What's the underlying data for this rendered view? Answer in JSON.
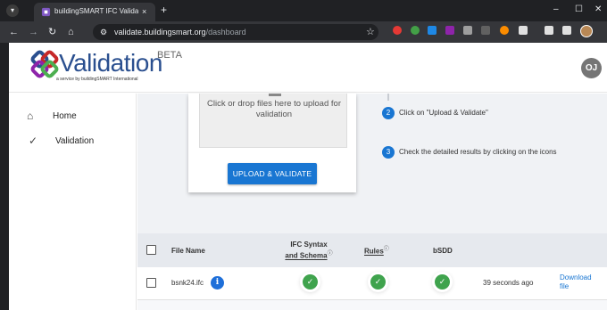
{
  "browser": {
    "tab_title": "buildingSMART IFC Validation S",
    "tab_close": "×",
    "new_tab": "+",
    "url_host": "validate.buildingsmart.org",
    "url_path": "/dashboard",
    "window_controls": [
      "–",
      "☐",
      "✕"
    ],
    "nav_icons": [
      "back-arrow-icon",
      "forward-arrow-icon",
      "reload-icon",
      "home-icon"
    ]
  },
  "header": {
    "logo_text": "Validation",
    "logo_subtitle": "a service by buildingSMART International",
    "beta_label": "BETA",
    "avatar_initials": "OJ"
  },
  "sidebar": {
    "items": [
      {
        "label": "Home",
        "icon": "home-icon"
      },
      {
        "label": "Validation",
        "icon": "check-icon"
      }
    ]
  },
  "upload": {
    "drop_text": "Click or drop files here to upload for validation",
    "button_label": "UPLOAD & VALIDATE"
  },
  "steps": [
    {
      "num": "2",
      "text": "Click on \"Upload & Validate\""
    },
    {
      "num": "3",
      "text": "Check the detailed results by clicking on the icons"
    }
  ],
  "table": {
    "headers": {
      "file_name": "File Name",
      "ifc_syntax_line1": "IFC Syntax",
      "ifc_syntax_line2": "and Schema",
      "rules": "Rules",
      "bsdd": "bSDD",
      "help_mark": "ⓘ"
    },
    "rows": [
      {
        "file_name": "bsnk24.ifc",
        "syntax_status": "pass",
        "rules_status": "pass",
        "bsdd_status": "pass",
        "time": "39 seconds ago",
        "download_line1": "Download",
        "download_line2": "file"
      }
    ]
  },
  "colors": {
    "accent": "#1976d2",
    "pass": "#3fa34d",
    "logo": "#2a4f8f"
  }
}
